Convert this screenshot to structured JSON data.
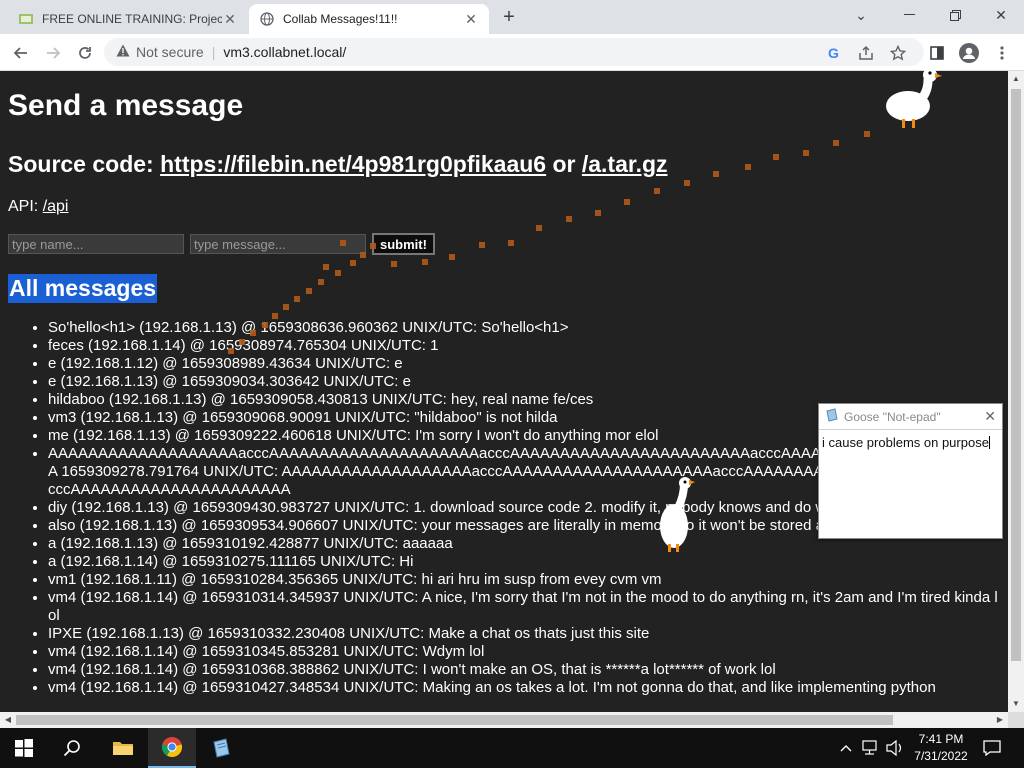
{
  "browser": {
    "tabs": [
      {
        "title": "FREE ONLINE TRAINING: Project",
        "active": false
      },
      {
        "title": "Collab Messages!11!!",
        "active": true
      }
    ],
    "new_tab": "+",
    "address": {
      "security": "Not secure",
      "separator": "|",
      "url": "vm3.collabnet.local/"
    }
  },
  "page": {
    "heading": "Send a message",
    "source": {
      "prefix": "Source code: ",
      "link1": "https://filebin.net/4p981rg0pfikaau6",
      "middle": " or ",
      "link2": "/a.tar.gz"
    },
    "api": {
      "label": "API: ",
      "link": "/api"
    },
    "form": {
      "name_placeholder": "type name...",
      "message_placeholder": "type message...",
      "submit": "submit!"
    },
    "messages_heading": "All messages",
    "messages": [
      "So'hello<h1> (192.168.1.13) @ 1659308636.960362 UNIX/UTC: So'hello<h1>",
      "feces (192.168.1.14) @ 1659308974.765304 UNIX/UTC: 1",
      "e (192.168.1.12) @ 1659308989.43634 UNIX/UTC: e",
      "e (192.168.1.13) @ 1659309034.303642 UNIX/UTC: e",
      "hildaboo (192.168.1.13) @ 1659309058.430813 UNIX/UTC: hey, real name fe/ces",
      "vm3 (192.168.1.13) @ 1659309068.90091 UNIX/UTC: \"hildaboo\" is not hilda",
      "me (192.168.1.13) @ 1659309222.460618 UNIX/UTC: I'm sorry I won't do anything mor elol",
      "AAAAAAAAAAAAAAAAAAAacccAAAAAAAAAAAAAAAAAAAAAacccAAAAAAAAAAAAAAAAAAAAAAAAacccAAAAAAAAAAAAAAAAAAAAAA 1659309278.791764 UNIX/UTC: AAAAAAAAAAAAAAAAAAAacccAAAAAAAAAAAAAAAAAAAAAacccAAAAAAAAAAAAAAAAAAAAAAAAacccAAAAAAAAAAAAAAAAAAAAAA",
      "diy (192.168.1.13) @ 1659309430.983727 UNIX/UTC: 1. download source code 2. modify it, nobody knows and do whatever tf you want",
      "also (192.168.1.13) @ 1659309534.906607 UNIX/UTC: your messages are literally in memory so it won't be stored anywhere lmao",
      "a (192.168.1.13) @ 1659310192.428877 UNIX/UTC: aaaaaa",
      "a (192.168.1.14) @ 1659310275.111165 UNIX/UTC: Hi",
      "vm1 (192.168.1.11) @ 1659310284.356365 UNIX/UTC: hi ari hru im susp from evey cvm vm",
      "vm4 (192.168.1.14) @ 1659310314.345937 UNIX/UTC: A nice, I'm sorry that I'm not in the mood to do anything rn, it's 2am and I'm tired kinda lol",
      "IPXE (192.168.1.13) @ 1659310332.230408 UNIX/UTC: Make a chat os thats just this site",
      "vm4 (192.168.1.14) @ 1659310345.853281 UNIX/UTC: Wdym lol",
      "vm4 (192.168.1.14) @ 1659310368.388862 UNIX/UTC: I won't make an OS, that is ******a lot****** of work lol",
      "vm4 (192.168.1.14) @ 1659310427.348534 UNIX/UTC: Making an os takes a lot. I'm not gonna do that, and like implementing python"
    ]
  },
  "goose_notepad": {
    "title": "Goose \"Not-epad\"",
    "text": "i cause problems on purpose"
  },
  "taskbar": {
    "time": "7:41 PM",
    "date": "7/31/2022"
  },
  "icons": [
    "windows-start-icon",
    "search-icon",
    "file-explorer-icon",
    "chrome-icon",
    "notepad-icon",
    "chevron-up-icon",
    "network-icon",
    "volume-icon",
    "notification-icon"
  ],
  "colors": {
    "page_bg": "#222222",
    "selection": "#1a5fd3",
    "taskbar": "#101010",
    "footprints": "#b05a1a"
  }
}
